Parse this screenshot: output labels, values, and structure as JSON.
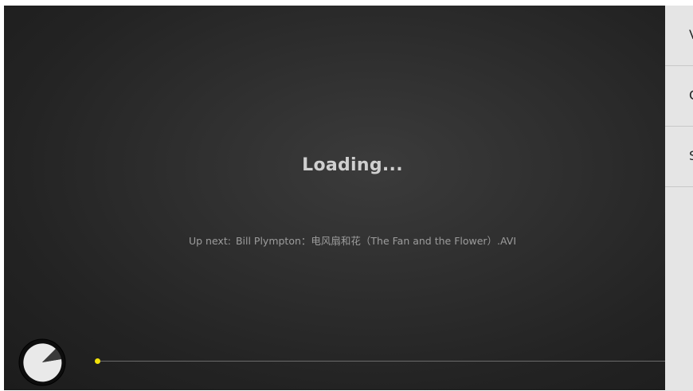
{
  "player": {
    "status": "Loading...",
    "up_next_label": "Up next:",
    "up_next_title": "Bill Plympton：电风扇和花（The Fan and the Flower）.AVI",
    "progress": 0.0,
    "accent_color": "#f2e20a"
  },
  "side_menu": {
    "items": [
      {
        "label_visible": "V"
      },
      {
        "label_visible": "C"
      },
      {
        "label_visible": "S"
      }
    ]
  },
  "icons": {
    "loading_knob": "loading-dial-icon"
  }
}
